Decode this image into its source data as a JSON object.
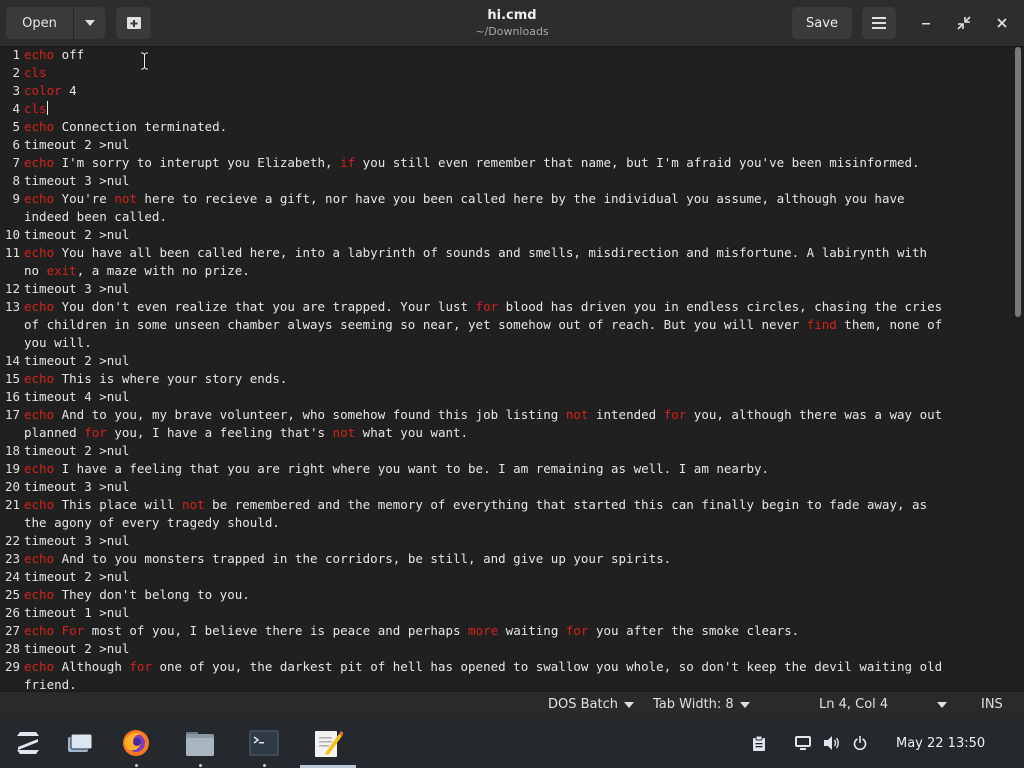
{
  "header": {
    "open_label": "Open",
    "save_label": "Save",
    "title": "hi.cmd",
    "subtitle": "~/Downloads"
  },
  "editor": {
    "lines": [
      {
        "n": "1",
        "segs": [
          {
            "t": "echo",
            "kw": true
          },
          {
            "t": " off"
          }
        ]
      },
      {
        "n": "2",
        "segs": [
          {
            "t": "cls",
            "kw": true
          }
        ]
      },
      {
        "n": "3",
        "segs": [
          {
            "t": "color",
            "kw": true
          },
          {
            "t": " 4"
          }
        ]
      },
      {
        "n": "4",
        "segs": [
          {
            "t": "cls",
            "kw": true
          }
        ],
        "caret": true
      },
      {
        "n": "5",
        "segs": [
          {
            "t": "echo",
            "kw": true
          },
          {
            "t": " Connection terminated."
          }
        ]
      },
      {
        "n": "6",
        "segs": [
          {
            "t": "timeout 2 >nul"
          }
        ]
      },
      {
        "n": "7",
        "segs": [
          {
            "t": "echo",
            "kw": true
          },
          {
            "t": " I'm sorry to interupt you Elizabeth, "
          },
          {
            "t": "if",
            "kw": true
          },
          {
            "t": " you still even remember that name, but I'm afraid you've been misinformed."
          }
        ]
      },
      {
        "n": "8",
        "segs": [
          {
            "t": "timeout 3 >nul"
          }
        ]
      },
      {
        "n": "9",
        "segs": [
          {
            "t": "echo",
            "kw": true
          },
          {
            "t": " You're "
          },
          {
            "t": "not",
            "kw": true
          },
          {
            "t": " here to recieve a gift, nor have you been called here by the individual you assume, although you have"
          }
        ]
      },
      {
        "n": "",
        "segs": [
          {
            "t": "indeed been called."
          }
        ]
      },
      {
        "n": "10",
        "segs": [
          {
            "t": "timeout 2 >nul"
          }
        ]
      },
      {
        "n": "11",
        "segs": [
          {
            "t": "echo",
            "kw": true
          },
          {
            "t": " You have all been called here, into a labyrinth of sounds and smells, misdirection and misfortune. A labirynth with"
          }
        ]
      },
      {
        "n": "",
        "segs": [
          {
            "t": "no "
          },
          {
            "t": "exit",
            "kw": true
          },
          {
            "t": ", a maze with no prize."
          }
        ]
      },
      {
        "n": "12",
        "segs": [
          {
            "t": "timeout 3 >nul"
          }
        ]
      },
      {
        "n": "13",
        "segs": [
          {
            "t": "echo",
            "kw": true
          },
          {
            "t": " You don't even realize that you are trapped. Your lust "
          },
          {
            "t": "for",
            "kw": true
          },
          {
            "t": " blood has driven you in endless circles, chasing the cries"
          }
        ]
      },
      {
        "n": "",
        "segs": [
          {
            "t": "of children in some unseen chamber always seeming so near, yet somehow out of reach. But you will never "
          },
          {
            "t": "find",
            "kw": true
          },
          {
            "t": " them, none of"
          }
        ]
      },
      {
        "n": "",
        "segs": [
          {
            "t": "you will."
          }
        ]
      },
      {
        "n": "14",
        "segs": [
          {
            "t": "timeout 2 >nul"
          }
        ]
      },
      {
        "n": "15",
        "segs": [
          {
            "t": "echo",
            "kw": true
          },
          {
            "t": " This is where your story ends."
          }
        ]
      },
      {
        "n": "16",
        "segs": [
          {
            "t": "timeout 4 >nul"
          }
        ]
      },
      {
        "n": "17",
        "segs": [
          {
            "t": "echo",
            "kw": true
          },
          {
            "t": " And to you, my brave volunteer, who somehow found this job listing "
          },
          {
            "t": "not",
            "kw": true
          },
          {
            "t": " intended "
          },
          {
            "t": "for",
            "kw": true
          },
          {
            "t": " you, although there was a way out"
          }
        ]
      },
      {
        "n": "",
        "segs": [
          {
            "t": "planned "
          },
          {
            "t": "for",
            "kw": true
          },
          {
            "t": " you, I have a feeling that's "
          },
          {
            "t": "not",
            "kw": true
          },
          {
            "t": " what you want."
          }
        ]
      },
      {
        "n": "18",
        "segs": [
          {
            "t": "timeout 2 >nul"
          }
        ]
      },
      {
        "n": "19",
        "segs": [
          {
            "t": "echo",
            "kw": true
          },
          {
            "t": " I have a feeling that you are right where you want to be. I am remaining as well. I am nearby."
          }
        ]
      },
      {
        "n": "20",
        "segs": [
          {
            "t": "timeout 3 >nul"
          }
        ]
      },
      {
        "n": "21",
        "segs": [
          {
            "t": "echo",
            "kw": true
          },
          {
            "t": " This place will "
          },
          {
            "t": "not",
            "kw": true
          },
          {
            "t": " be remembered and the memory of everything that started this can finally begin to fade away, as"
          }
        ]
      },
      {
        "n": "",
        "segs": [
          {
            "t": "the agony of every tragedy should."
          }
        ]
      },
      {
        "n": "22",
        "segs": [
          {
            "t": "timeout 3 >nul"
          }
        ]
      },
      {
        "n": "23",
        "segs": [
          {
            "t": "echo",
            "kw": true
          },
          {
            "t": " And to you monsters trapped in the corridors, be still, and give up your spirits."
          }
        ]
      },
      {
        "n": "24",
        "segs": [
          {
            "t": "timeout 2 >nul"
          }
        ]
      },
      {
        "n": "25",
        "segs": [
          {
            "t": "echo",
            "kw": true
          },
          {
            "t": " They don't belong to you."
          }
        ]
      },
      {
        "n": "26",
        "segs": [
          {
            "t": "timeout 1 >nul"
          }
        ]
      },
      {
        "n": "27",
        "segs": [
          {
            "t": "echo",
            "kw": true
          },
          {
            "t": " "
          },
          {
            "t": "For",
            "kw": true
          },
          {
            "t": " most of you, I believe there is peace and perhaps "
          },
          {
            "t": "more",
            "kw": true
          },
          {
            "t": " waiting "
          },
          {
            "t": "for",
            "kw": true
          },
          {
            "t": " you after the smoke clears."
          }
        ]
      },
      {
        "n": "28",
        "segs": [
          {
            "t": "timeout 2 >nul"
          }
        ]
      },
      {
        "n": "29",
        "segs": [
          {
            "t": "echo",
            "kw": true
          },
          {
            "t": " Although "
          },
          {
            "t": "for",
            "kw": true
          },
          {
            "t": " one of you, the darkest pit of hell has opened to swallow you whole, so don't keep the devil waiting old"
          }
        ]
      },
      {
        "n": "",
        "segs": [
          {
            "t": "friend."
          }
        ]
      }
    ]
  },
  "statusbar": {
    "language": "DOS Batch",
    "tab_width": "Tab Width: 8",
    "position": "Ln 4, Col 4",
    "mode": "INS"
  },
  "taskbar": {
    "clock": "May 22  13:50"
  },
  "colors": {
    "keyword": "#d6201a",
    "background": "#202020",
    "header": "#2d2d2d"
  },
  "icons": [
    "dropdown-arrow-icon",
    "new-tab-icon",
    "hamburger-menu-icon",
    "minimize-icon",
    "restore-icon",
    "close-icon",
    "zorin-menu-icon",
    "workspace-icon",
    "firefox-icon",
    "files-icon",
    "terminal-icon",
    "text-editor-icon",
    "clipboard-icon",
    "display-icon",
    "volume-icon",
    "power-icon"
  ]
}
